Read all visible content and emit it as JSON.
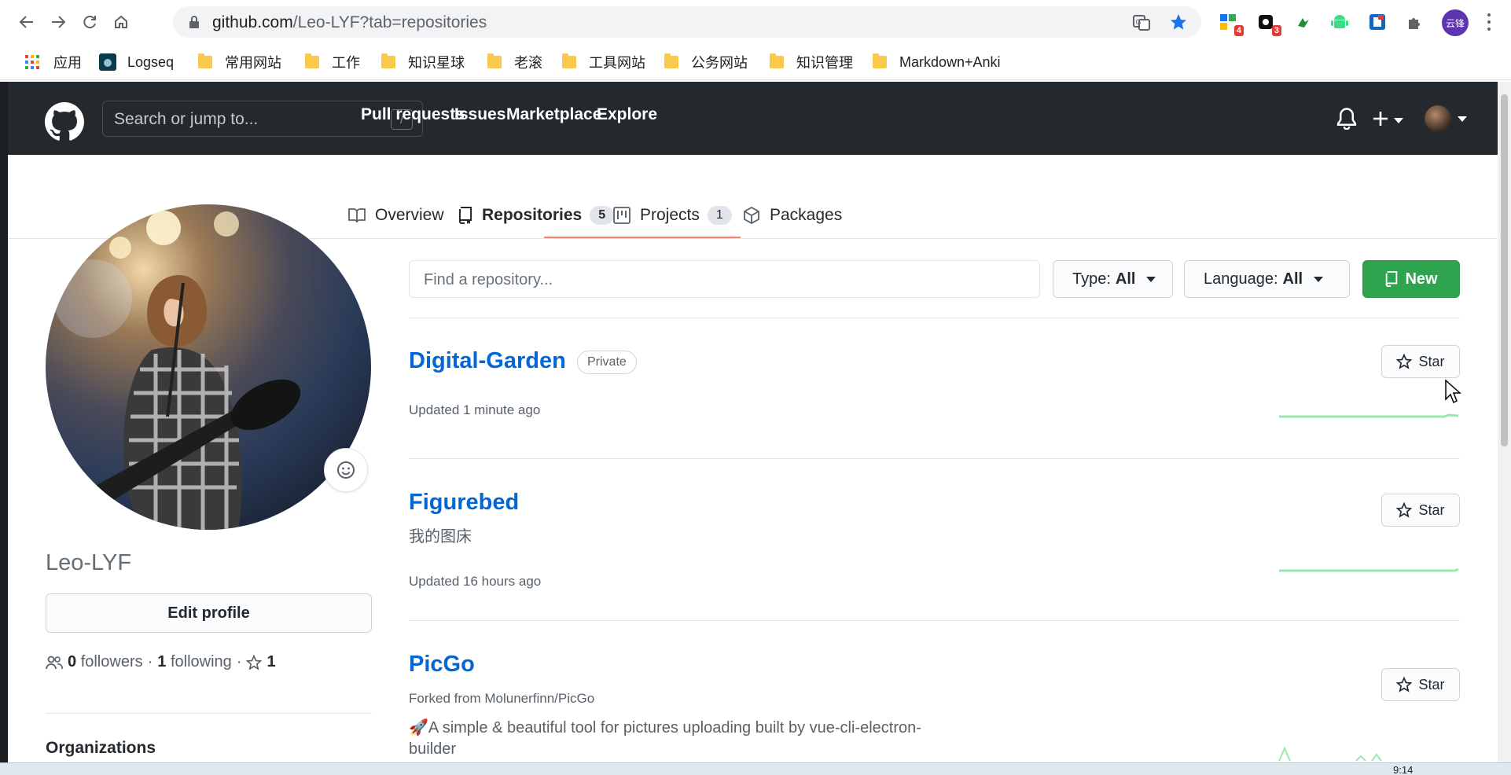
{
  "browser": {
    "url_host": "github.com",
    "url_rest": "/Leo-LYF?tab=repositories",
    "extension_badges": [
      "4",
      "3"
    ],
    "profile_label": "云锋"
  },
  "bookmarks": [
    {
      "label": "应用",
      "icon": "apps-grid-icon"
    },
    {
      "label": "Logseq",
      "icon": "logseq-icon"
    },
    {
      "label": "常用网站",
      "icon": "folder-icon"
    },
    {
      "label": "工作",
      "icon": "folder-icon"
    },
    {
      "label": "知识星球",
      "icon": "folder-icon"
    },
    {
      "label": "老滚",
      "icon": "folder-icon"
    },
    {
      "label": "工具网站",
      "icon": "folder-icon"
    },
    {
      "label": "公务网站",
      "icon": "folder-icon"
    },
    {
      "label": "知识管理",
      "icon": "folder-icon"
    },
    {
      "label": "Markdown+Anki",
      "icon": "folder-icon"
    }
  ],
  "header": {
    "search_placeholder": "Search or jump to...",
    "search_shortcut": "/",
    "nav": [
      "Pull requests",
      "Issues",
      "Marketplace",
      "Explore"
    ]
  },
  "tabs": [
    {
      "label": "Overview",
      "count": null,
      "icon": "book-icon"
    },
    {
      "label": "Repositories",
      "count": "5",
      "icon": "repo-icon",
      "active": true
    },
    {
      "label": "Projects",
      "count": "1",
      "icon": "project-icon"
    },
    {
      "label": "Packages",
      "count": null,
      "icon": "package-icon"
    }
  ],
  "profile": {
    "username": "Leo-LYF",
    "edit_label": "Edit profile",
    "followers_count": "0",
    "followers_label": "followers",
    "following_count": "1",
    "following_label": "following",
    "stars_count": "1",
    "orgs_heading": "Organizations"
  },
  "filters": {
    "find_placeholder": "Find a repository...",
    "type_label": "Type:",
    "type_value": "All",
    "language_label": "Language:",
    "language_value": "All",
    "new_label": "New"
  },
  "repos": [
    {
      "name": "Digital-Garden",
      "badge": "Private",
      "updated": "Updated 1 minute ago",
      "star_label": "Star"
    },
    {
      "name": "Figurebed",
      "description": "我的图床",
      "updated": "Updated 16 hours ago",
      "star_label": "Star"
    },
    {
      "name": "PicGo",
      "forked_from": "Forked from Molunerfinn/PicGo",
      "description_line1": "🚀A simple & beautiful tool for pictures uploading built by vue-cli-electron-",
      "description_line2": "builder",
      "star_label": "Star"
    }
  ],
  "taskbar": {
    "clock": "9:14"
  },
  "colors": {
    "header_bg": "#24292e",
    "link_blue": "#0366d6",
    "new_green": "#2ea44f",
    "tab_underline": "#f9826c",
    "spark_green": "#9be9a8"
  }
}
